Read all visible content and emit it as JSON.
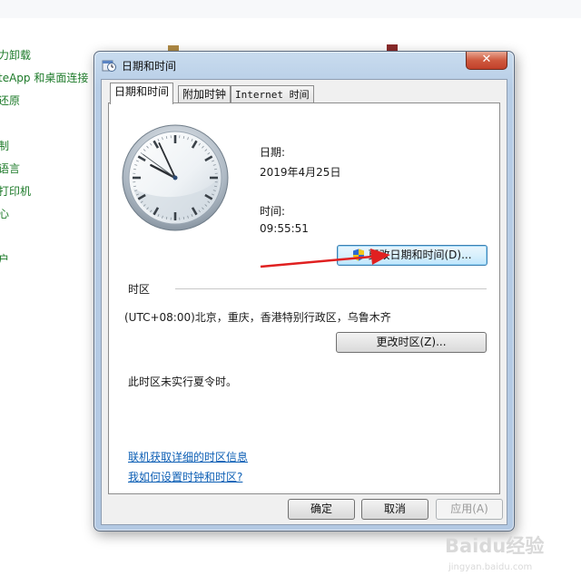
{
  "background": {
    "links": [
      "力卸载",
      "teApp 和桌面连接",
      "还原",
      "",
      "制",
      "语言",
      "打印机",
      "心",
      "",
      "户"
    ]
  },
  "window": {
    "title": "日期和时间",
    "close_symbol": "✕",
    "tabs": [
      "日期和时间",
      "附加时钟",
      "Internet 时间"
    ],
    "date_label": "日期:",
    "date_value": "2019年4月25日",
    "time_label": "时间:",
    "time_value": "09:55:51",
    "change_datetime_button": "更改日期和时间(D)...",
    "timezone_header": "时区",
    "timezone_value": "(UTC+08:00)北京，重庆，香港特别行政区，乌鲁木齐",
    "change_timezone_button": "更改时区(Z)...",
    "dst_note": "此时区未实行夏令时。",
    "link_timezone_info": "联机获取详细的时区信息",
    "link_how_to_set": "我如何设置时钟和时区?",
    "ok_button": "确定",
    "cancel_button": "取消",
    "apply_button": "应用(A)"
  },
  "clock": {
    "hour": 9,
    "minute": 55,
    "second": 51
  },
  "watermark": {
    "brand": "Baidu经验",
    "url": "jingyan.baidu.com"
  },
  "icons": {
    "title": "clock-calendar-icon",
    "shield": "uac-shield-icon",
    "annotation": "red-arrow-icon"
  },
  "colors": {
    "link_green": "#1e7b2a",
    "link_blue": "#0d5fb5",
    "close_red": "#c2402a",
    "arrow_red": "#e02020"
  }
}
